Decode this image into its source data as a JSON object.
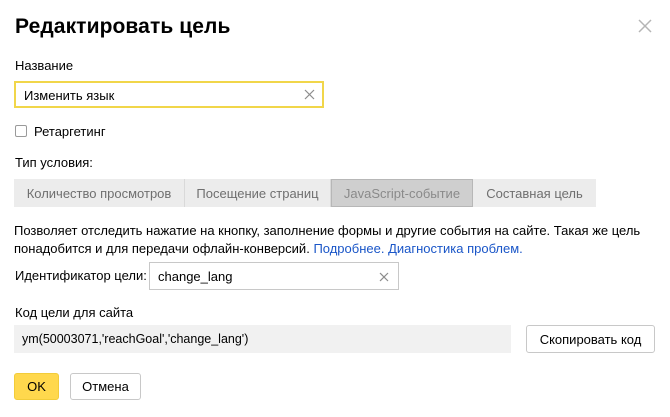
{
  "dialog": {
    "title": "Редактировать цель",
    "close_icon": "close-icon"
  },
  "name_field": {
    "label": "Название",
    "value": "Изменить язык",
    "clear_icon": "clear-icon"
  },
  "retargeting": {
    "label": "Ретаргетинг",
    "checked": false
  },
  "condition": {
    "label": "Тип условия:",
    "tabs": [
      {
        "label": "Количество просмотров",
        "active": false
      },
      {
        "label": "Посещение страниц",
        "active": false
      },
      {
        "label": "JavaScript-событие",
        "active": true
      },
      {
        "label": "Составная цель",
        "active": false
      }
    ]
  },
  "description": {
    "text": "Позволяет отследить нажатие на кнопку, заполнение формы и другие события на сайте. Такая же цель понадобится и для передачи офлайн-конверсий.",
    "link_more": "Подробнее.",
    "link_diagnostics": "Диагностика проблем."
  },
  "identifier": {
    "label": "Идентификатор цели:",
    "value": "change_lang",
    "clear_icon": "clear-icon"
  },
  "code": {
    "label": "Код цели для сайта",
    "value": "ym(50003071,'reachGoal','change_lang')",
    "copy_label": "Скопировать код"
  },
  "actions": {
    "ok_label": "OK",
    "cancel_label": "Отмена"
  },
  "colors": {
    "accent_yellow": "#ffd84d",
    "input_focus_border": "#f1d64a",
    "link": "#1a56c8"
  }
}
